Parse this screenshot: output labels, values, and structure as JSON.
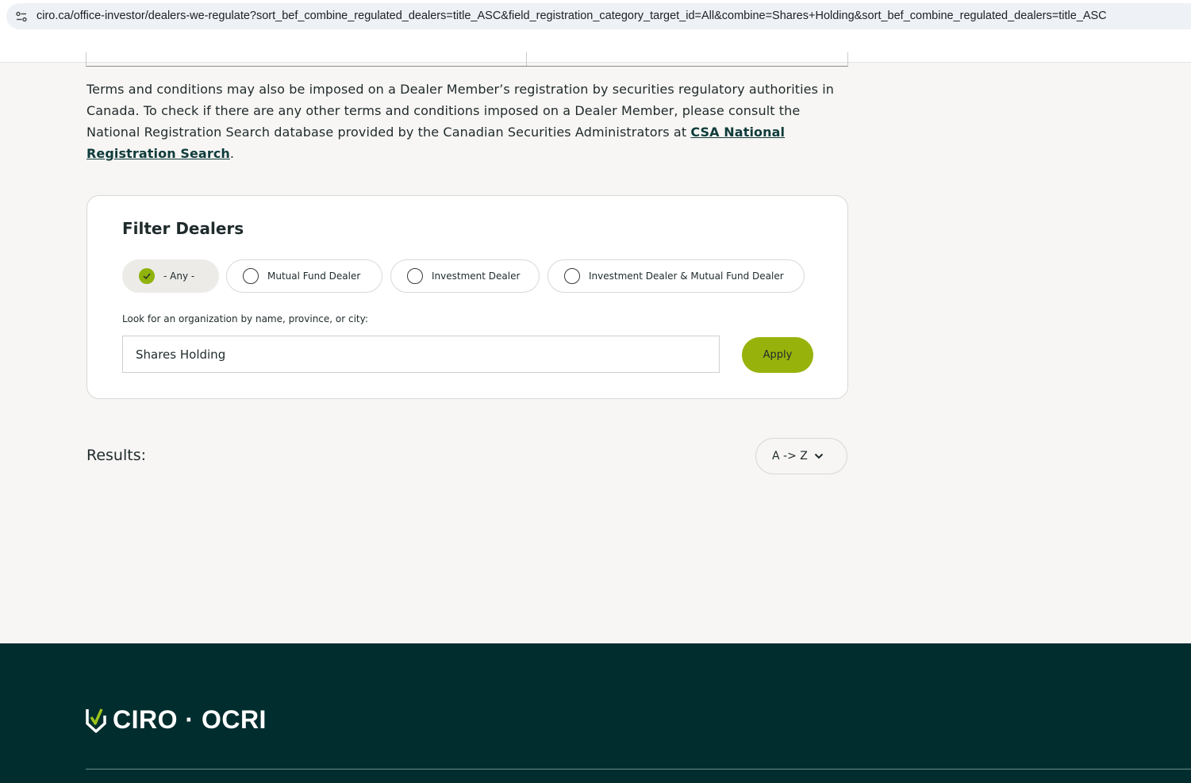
{
  "browser": {
    "url": "ciro.ca/office-investor/dealers-we-regulate?sort_bef_combine_regulated_dealers=title_ASC&field_registration_category_target_id=All&combine=Shares+Holding&sort_bef_combine_regulated_dealers=title_ASC"
  },
  "terms": {
    "text": "Terms and conditions may also be imposed on a Dealer Member’s registration by securities regulatory authorities in Canada. To check if there are any other terms and conditions imposed on a Dealer Member, please consult the National Registration Search database provided by the Canadian Securities Administrators at ",
    "link_text": "CSA National Registration Search",
    "suffix": "."
  },
  "filter": {
    "title": "Filter Dealers",
    "options": [
      {
        "label": "- Any -",
        "selected": true
      },
      {
        "label": "Mutual Fund Dealer",
        "selected": false
      },
      {
        "label": "Investment Dealer",
        "selected": false
      },
      {
        "label": "Investment Dealer & Mutual Fund Dealer",
        "selected": false
      }
    ],
    "search_label": "Look for an organization by name, province, or city:",
    "search_value": "Shares Holding",
    "apply_label": "Apply"
  },
  "results": {
    "label": "Results:",
    "sort_value": "A -> Z"
  },
  "footer": {
    "logo_text": "CIRO · OCRI"
  },
  "colors": {
    "accent": "#98b20c",
    "footer_bg": "#022d2e",
    "page_bg": "#f7f6f4"
  }
}
